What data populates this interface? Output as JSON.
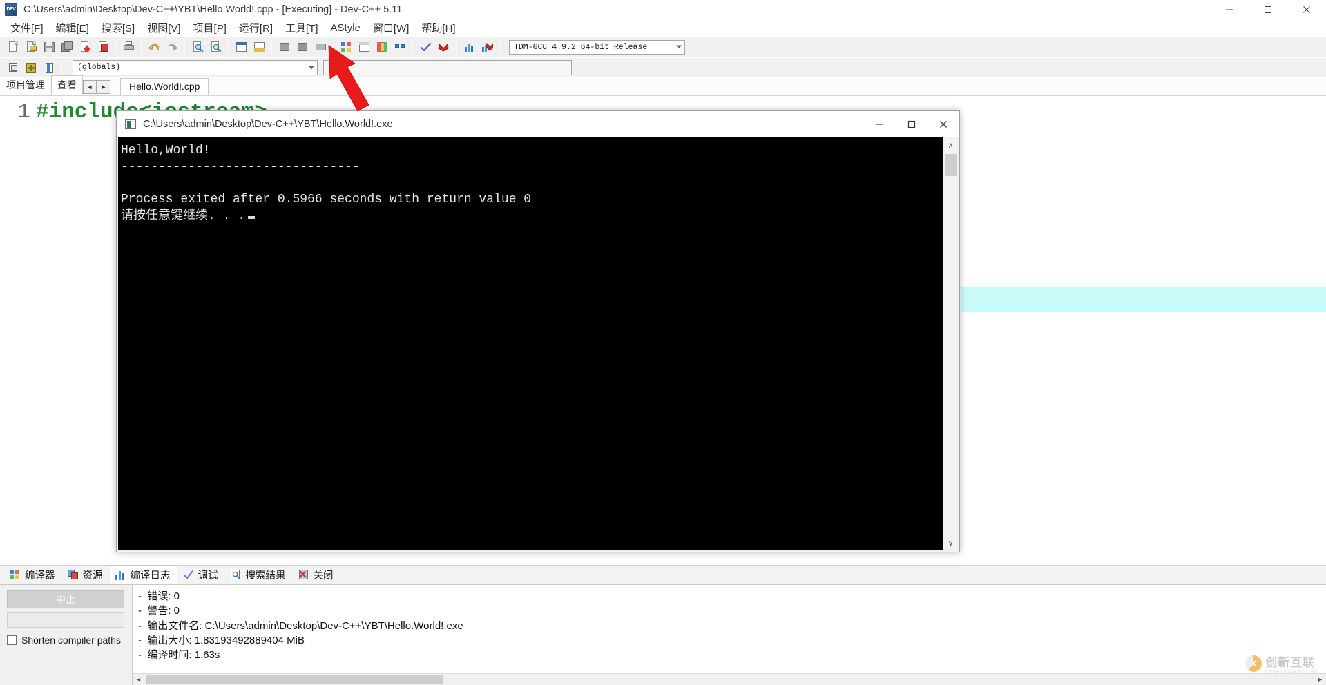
{
  "window": {
    "title": "C:\\Users\\admin\\Desktop\\Dev-C++\\YBT\\Hello.World!.cpp - [Executing] - Dev-C++ 5.11",
    "app_icon": "devcpp-icon",
    "minimize_label": "—",
    "maximize_label": "□",
    "close_label": "✕"
  },
  "menubar": {
    "items": [
      {
        "label": "文件[F]",
        "name": "menu-file"
      },
      {
        "label": "编辑[E]",
        "name": "menu-edit"
      },
      {
        "label": "搜索[S]",
        "name": "menu-search"
      },
      {
        "label": "视图[V]",
        "name": "menu-view"
      },
      {
        "label": "项目[P]",
        "name": "menu-project"
      },
      {
        "label": "运行[R]",
        "name": "menu-run"
      },
      {
        "label": "工具[T]",
        "name": "menu-tools"
      },
      {
        "label": "AStyle",
        "name": "menu-astyle"
      },
      {
        "label": "窗口[W]",
        "name": "menu-window"
      },
      {
        "label": "帮助[H]",
        "name": "menu-help"
      }
    ]
  },
  "toolbar": {
    "compiler_select": "TDM-GCC 4.9.2 64-bit Release",
    "buttons": [
      "new-file-icon",
      "open-file-icon",
      "save-icon",
      "save-all-icon",
      "close-file-icon",
      "close-all-icon",
      "print-icon",
      "undo-icon",
      "redo-icon",
      "find-icon",
      "replace-icon",
      "goto-line-icon",
      "goto-function-icon",
      "compile-icon",
      "run-icon",
      "compile-and-run-icon",
      "rebuild-icon",
      "debug-icon",
      "profile-icon",
      "project-options-icon",
      "syntax-check-icon",
      "stop-execution-icon",
      "profile-analysis-icon",
      "delete-profile-icon"
    ]
  },
  "toolbar2": {
    "scope_select": "(globals)",
    "member_select": "",
    "buttons": [
      "insert-icon",
      "toggle-icon",
      "goto-declaration-icon"
    ]
  },
  "panel_tabs": {
    "items": [
      {
        "label": "项目管理",
        "name": "panel-tab-project-manager",
        "active": false
      },
      {
        "label": "查看",
        "name": "panel-tab-view",
        "active": true
      }
    ],
    "nav_prev": "◄",
    "nav_next": "►"
  },
  "editor": {
    "tab_label": "Hello.World!.cpp",
    "line_number": "1",
    "line_text": "#include<iostream>",
    "highlight_color": "#c9fbfb"
  },
  "console": {
    "title": "C:\\Users\\admin\\Desktop\\Dev-C++\\YBT\\Hello.World!.exe",
    "icon": "console-window-icon",
    "minimize_label": "—",
    "maximize_label": "□",
    "close_label": "✕",
    "lines": [
      "Hello,World!",
      "--------------------------------",
      "Process exited after 0.5966 seconds with return value 0",
      "请按任意键继续. . ."
    ],
    "scroll_up": "∧",
    "scroll_down": "∨"
  },
  "bottom_tabs": {
    "items": [
      {
        "label": "编译器",
        "icon": "compiler-icon",
        "name": "bottom-tab-compiler",
        "active": false
      },
      {
        "label": "资源",
        "icon": "resources-icon",
        "name": "bottom-tab-resources",
        "active": false
      },
      {
        "label": "编译日志",
        "icon": "compile-log-icon",
        "name": "bottom-tab-compile-log",
        "active": true
      },
      {
        "label": "调试",
        "icon": "debug-check-icon",
        "name": "bottom-tab-debug",
        "active": false
      },
      {
        "label": "搜索结果",
        "icon": "search-results-icon",
        "name": "bottom-tab-search-results",
        "active": false
      },
      {
        "label": "关闭",
        "icon": "close-red-icon",
        "name": "bottom-tab-close",
        "active": false
      }
    ]
  },
  "compile_panel": {
    "abort_label": "中止",
    "shorten_paths_label": "Shorten compiler paths",
    "shorten_paths_checked": false,
    "log_lines": [
      "-  错误: 0",
      "-  警告: 0",
      "-  输出文件名: C:\\Users\\admin\\Desktop\\Dev-C++\\YBT\\Hello.World!.exe",
      "-  输出大小: 1.83193492889404 MiB",
      "-  编译时间: 1.63s"
    ],
    "hscroll_left": "◄",
    "hscroll_right": "►"
  },
  "annotation": {
    "arrow_color": "#e81a1a",
    "arrow_name": "red-pointer-arrow"
  },
  "watermark": {
    "text": "创新互联",
    "sub": "CHUANGXIN HULIAN",
    "logo": "cx-logo-icon"
  }
}
